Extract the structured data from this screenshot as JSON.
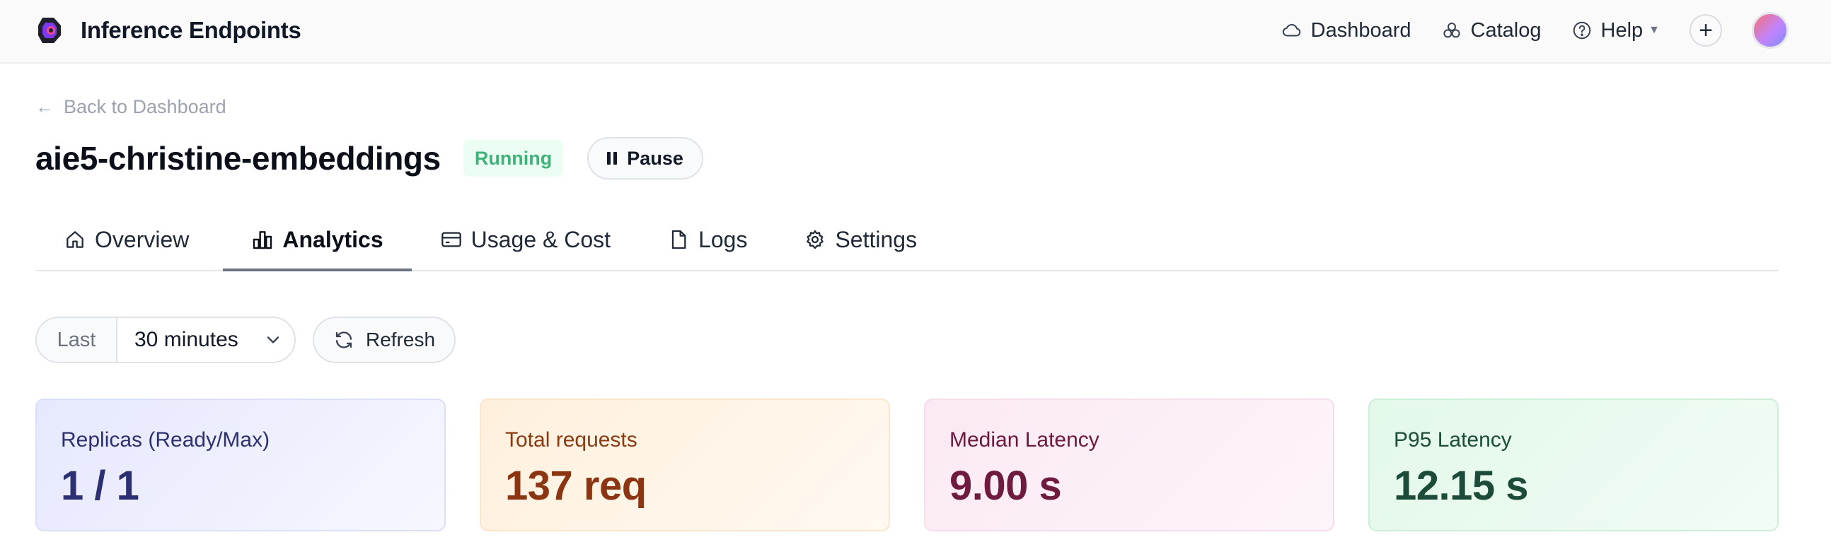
{
  "app": {
    "title": "Inference Endpoints",
    "logo_icon": "hugging-face-endpoints-logo"
  },
  "nav": {
    "items": [
      {
        "label": "Dashboard",
        "icon": "cloud-icon"
      },
      {
        "label": "Catalog",
        "icon": "catalog-icon"
      },
      {
        "label": "Help",
        "icon": "help-circle-icon"
      }
    ],
    "plus_icon": "plus-icon",
    "avatar_colors": [
      "#f87171",
      "#c084fc",
      "#818cf8"
    ]
  },
  "header": {
    "back_label": "Back to Dashboard",
    "endpoint_name": "aie5-christine-embeddings",
    "status": "Running",
    "status_color": "#3fb37a",
    "pause_label": "Pause"
  },
  "tabs": [
    {
      "label": "Overview",
      "icon": "home-icon",
      "active": false
    },
    {
      "label": "Analytics",
      "icon": "bar-chart-icon",
      "active": true
    },
    {
      "label": "Usage & Cost",
      "icon": "credit-card-icon",
      "active": false
    },
    {
      "label": "Logs",
      "icon": "file-icon",
      "active": false
    },
    {
      "label": "Settings",
      "icon": "gear-icon",
      "active": false
    }
  ],
  "controls": {
    "range_prefix": "Last",
    "range_value": "30 minutes",
    "refresh_label": "Refresh"
  },
  "metrics": [
    {
      "label": "Replicas (Ready/Max)",
      "value": "1 / 1",
      "accent": "#2d2f73"
    },
    {
      "label": "Total requests",
      "value": "137 req",
      "accent": "#8b3513"
    },
    {
      "label": "Median Latency",
      "value": "9.00 s",
      "accent": "#6f1b3f"
    },
    {
      "label": "P95 Latency",
      "value": "12.15 s",
      "accent": "#1c4b39"
    }
  ]
}
